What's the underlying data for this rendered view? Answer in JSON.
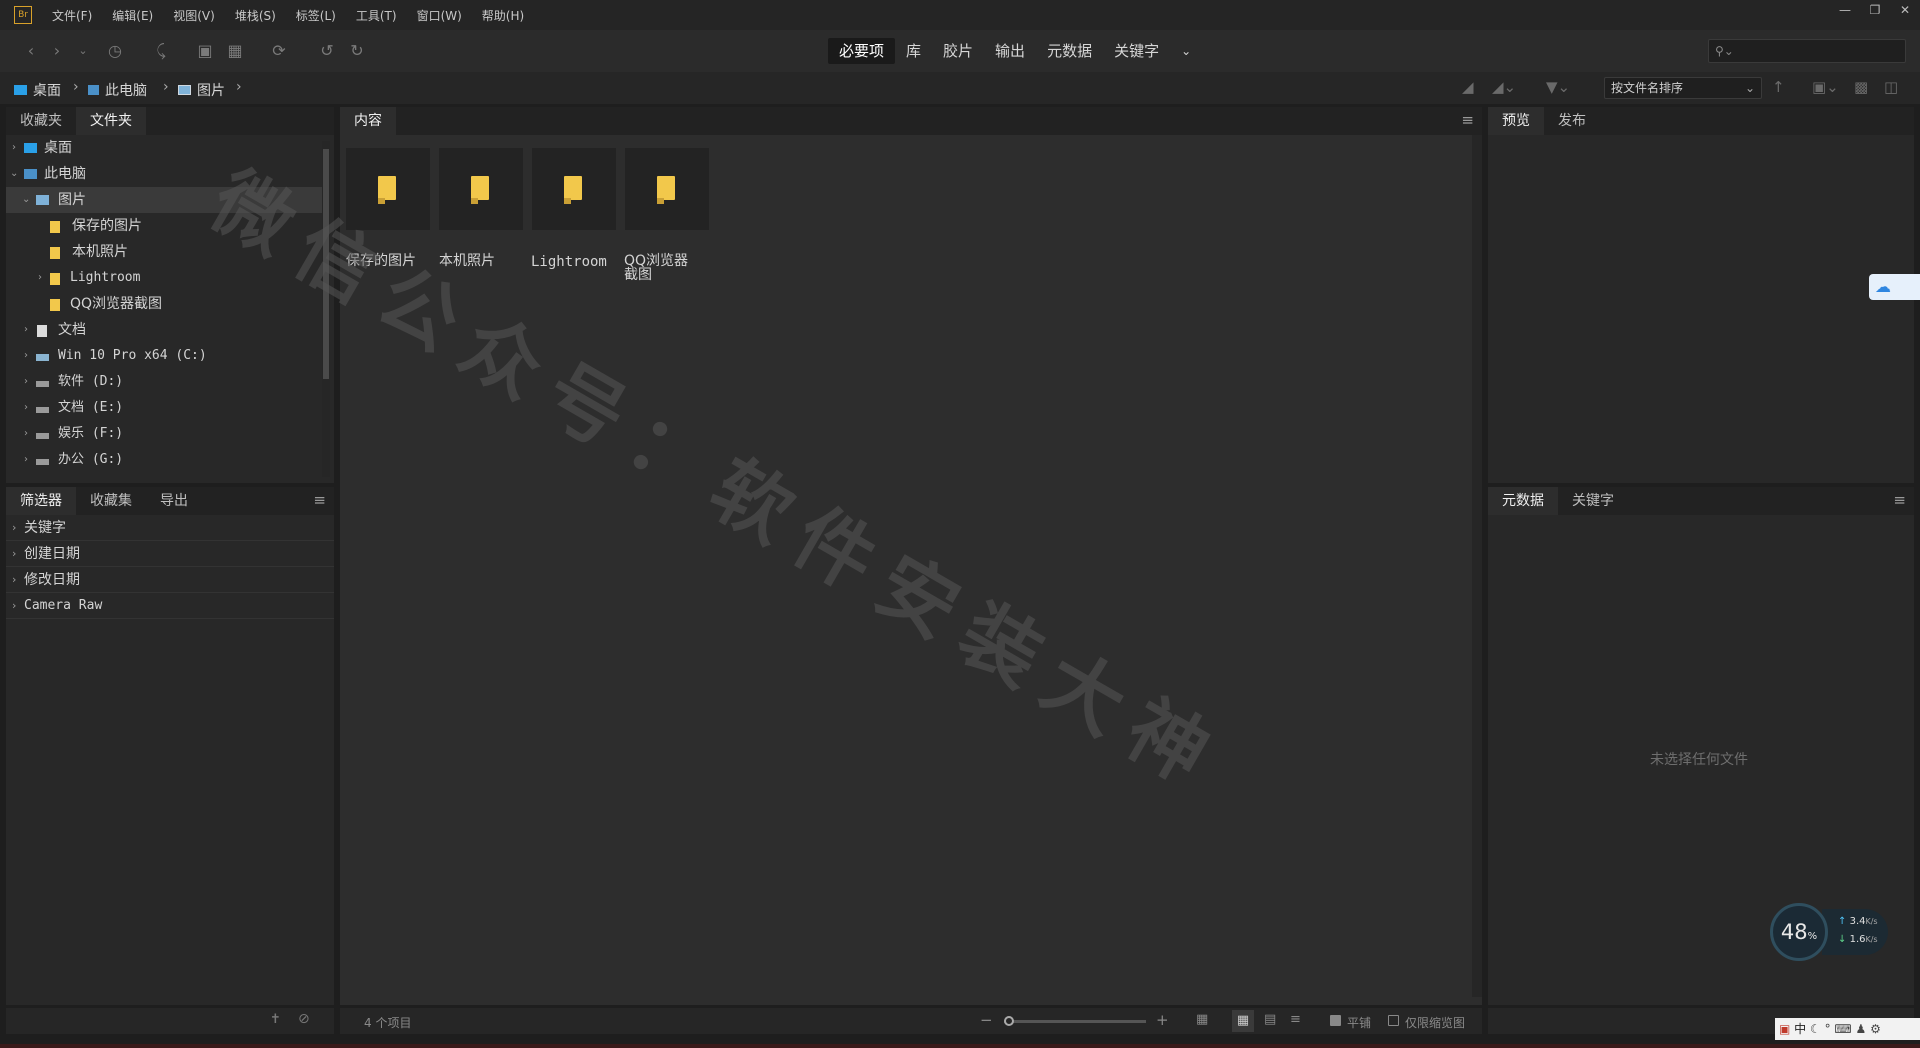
{
  "app": {
    "logo": "Br"
  },
  "menu": [
    "文件(F)",
    "编辑(E)",
    "视图(V)",
    "堆栈(S)",
    "标签(L)",
    "工具(T)",
    "窗口(W)",
    "帮助(H)"
  ],
  "workspaces": [
    "必要项",
    "库",
    "胶片",
    "输出",
    "元数据",
    "关键字"
  ],
  "active_workspace": "必要项",
  "breadcrumbs": [
    "桌面",
    "此电脑",
    "图片"
  ],
  "sort": {
    "label": "按文件名排序"
  },
  "left_top_tabs": [
    "收藏夹",
    "文件夹"
  ],
  "tree": [
    {
      "label": "桌面",
      "level": 0,
      "icon": "desktop-icon"
    },
    {
      "label": "此电脑",
      "level": 0,
      "icon": "computer-icon",
      "expanded": true
    },
    {
      "label": "图片",
      "level": 1,
      "icon": "pictures-icon",
      "expanded": true,
      "selected": true
    },
    {
      "label": "保存的图片",
      "level": 2,
      "icon": "folder-icon"
    },
    {
      "label": "本机照片",
      "level": 2,
      "icon": "folder-icon"
    },
    {
      "label": "Lightroom",
      "level": 2,
      "icon": "folder-icon"
    },
    {
      "label": "QQ浏览器截图",
      "level": 2,
      "icon": "folder-icon"
    },
    {
      "label": "文档",
      "level": 1,
      "icon": "document-icon"
    },
    {
      "label": "Win 10 Pro x64 (C:)",
      "level": 1,
      "icon": "drive-icon"
    },
    {
      "label": "软件 (D:)",
      "level": 1,
      "icon": "drive-icon"
    },
    {
      "label": "文档 (E:)",
      "level": 1,
      "icon": "drive-icon"
    },
    {
      "label": "娱乐 (F:)",
      "level": 1,
      "icon": "drive-icon"
    },
    {
      "label": "办公 (G:)",
      "level": 1,
      "icon": "drive-icon"
    }
  ],
  "left_bottom_tabs": [
    "筛选器",
    "收藏集",
    "导出"
  ],
  "filters": [
    "关键字",
    "创建日期",
    "修改日期",
    "Camera Raw"
  ],
  "content": {
    "tab": "内容",
    "items": [
      "保存的图片",
      "本机照片",
      "Lightroom",
      "QQ浏览器截图"
    ],
    "count_text": "4 个项目"
  },
  "view_options": {
    "flat": "平铺",
    "thumbs_only": "仅限缩览图"
  },
  "right_top_tabs": [
    "预览",
    "发布"
  ],
  "right_bottom_tabs": [
    "元数据",
    "关键字"
  ],
  "metadata_empty": "未选择任何文件",
  "watermark": "微信公众号：软件安装大神",
  "system": {
    "gauge": "48",
    "gauge_unit": "%",
    "upload": "3.4",
    "download": "1.6",
    "speed_unit": "K/s",
    "ime": "中"
  }
}
